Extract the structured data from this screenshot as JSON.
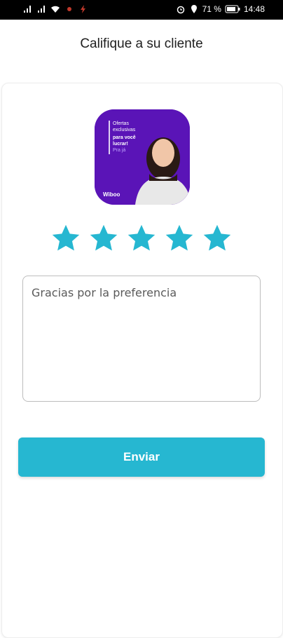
{
  "status_bar": {
    "battery_percent": "71 %",
    "time": "14:48",
    "icons": [
      "signal-icon",
      "signal-icon",
      "wifi-icon",
      "notification-icon",
      "flash-icon",
      "alarm-icon",
      "location-icon",
      "battery-icon"
    ]
  },
  "header": {
    "title": "Califique a su cliente"
  },
  "client_card": {
    "avatar": {
      "promo_text": [
        "Ofertas",
        "exclusivas",
        "para você",
        "lucrar!",
        "Pra já"
      ],
      "brand": "Wiboo",
      "background_color": "#5a14b7"
    },
    "rating": {
      "value": 5,
      "max": 5,
      "star_color": "#26b7d1"
    },
    "comment": {
      "value": "Gracias por la preferencia"
    },
    "submit_label": "Enviar"
  },
  "colors": {
    "accent": "#26b7d1"
  }
}
